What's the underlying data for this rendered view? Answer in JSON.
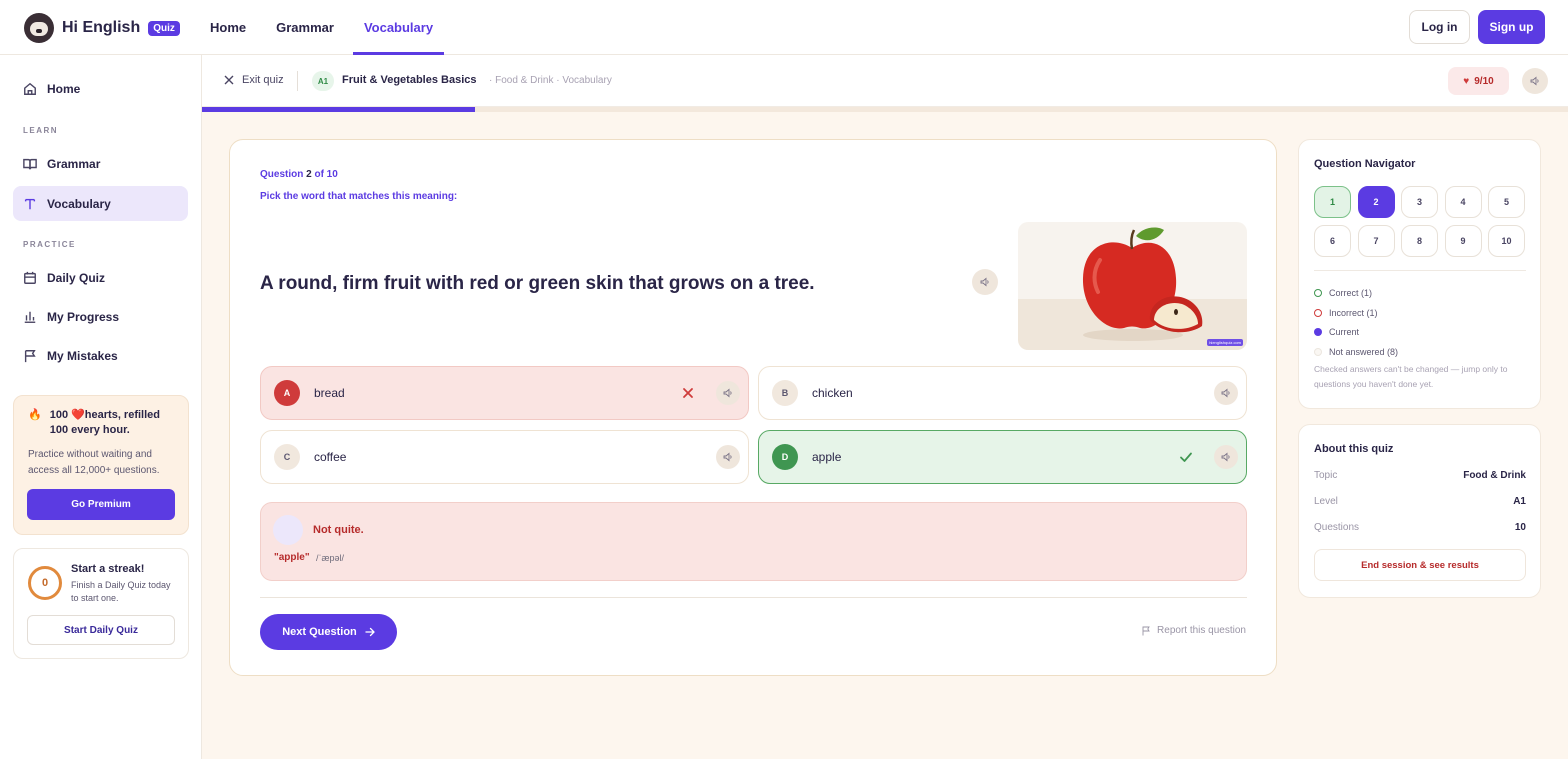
{
  "brand": {
    "name": "Hi English",
    "badge": "Quiz"
  },
  "topnav": {
    "items": [
      "Home",
      "Grammar",
      "Vocabulary"
    ],
    "active": "Vocabulary"
  },
  "auth": {
    "login": "Log in",
    "signup": "Sign up"
  },
  "sidebar": {
    "home": "Home",
    "learn_head": "LEARN",
    "grammar": "Grammar",
    "vocabulary": "Vocabulary",
    "practice_head": "PRACTICE",
    "daily_quiz": "Daily Quiz",
    "my_progress": "My Progress",
    "my_mistakes": "My Mistakes"
  },
  "promo": {
    "title": "100 ❤️hearts, refilled 100 every hour.",
    "text": "Practice without waiting and access all 12,000+ questions.",
    "button": "Go Premium"
  },
  "streak": {
    "count": "0",
    "title": "Start a streak!",
    "text": "Finish a Daily Quiz today to start one.",
    "button": "Start Daily Quiz"
  },
  "quiz_header": {
    "exit": "Exit quiz",
    "level": "A1",
    "title": "Fruit & Vegetables Basics",
    "subtitle": "· Food & Drink · Vocabulary",
    "hearts": "9/10",
    "progress_fraction": 0.2
  },
  "question": {
    "label": "Question",
    "number": "2",
    "of": "of 10",
    "prompt": "Pick the word that matches this meaning:",
    "definition": "A round, firm fruit with red or green skin that grows on a tree.",
    "image_credit": "hienglishquiz.com",
    "options": [
      {
        "letter": "A",
        "text": "bread",
        "state": "wrong"
      },
      {
        "letter": "B",
        "text": "chicken",
        "state": "neutral"
      },
      {
        "letter": "C",
        "text": "coffee",
        "state": "neutral"
      },
      {
        "letter": "D",
        "text": "apple",
        "state": "correct"
      }
    ],
    "feedback": {
      "title": "Not quite.",
      "word": "\"apple\"",
      "ipa": "/ˈæpəl/"
    },
    "next": "Next Question",
    "report": "Report this question"
  },
  "navigator": {
    "title": "Question Navigator",
    "cells": [
      "1",
      "2",
      "3",
      "4",
      "5",
      "6",
      "7",
      "8",
      "9",
      "10"
    ],
    "legend": {
      "correct": "Correct (1)",
      "incorrect": "Incorrect (1)",
      "current": "Current",
      "not_answered": "Not answered (8)"
    },
    "note": "Checked answers can't be changed — jump only to questions you haven't done yet."
  },
  "about": {
    "title": "About this quiz",
    "rows": [
      {
        "k": "Topic",
        "v": "Food & Drink"
      },
      {
        "k": "Level",
        "v": "A1"
      },
      {
        "k": "Questions",
        "v": "10"
      }
    ],
    "end": "End session & see results"
  },
  "colors": {
    "accent": "#5b3be2",
    "correct": "#3f9651",
    "wrong": "#cf3b3b",
    "background": "#fdf6ee"
  }
}
